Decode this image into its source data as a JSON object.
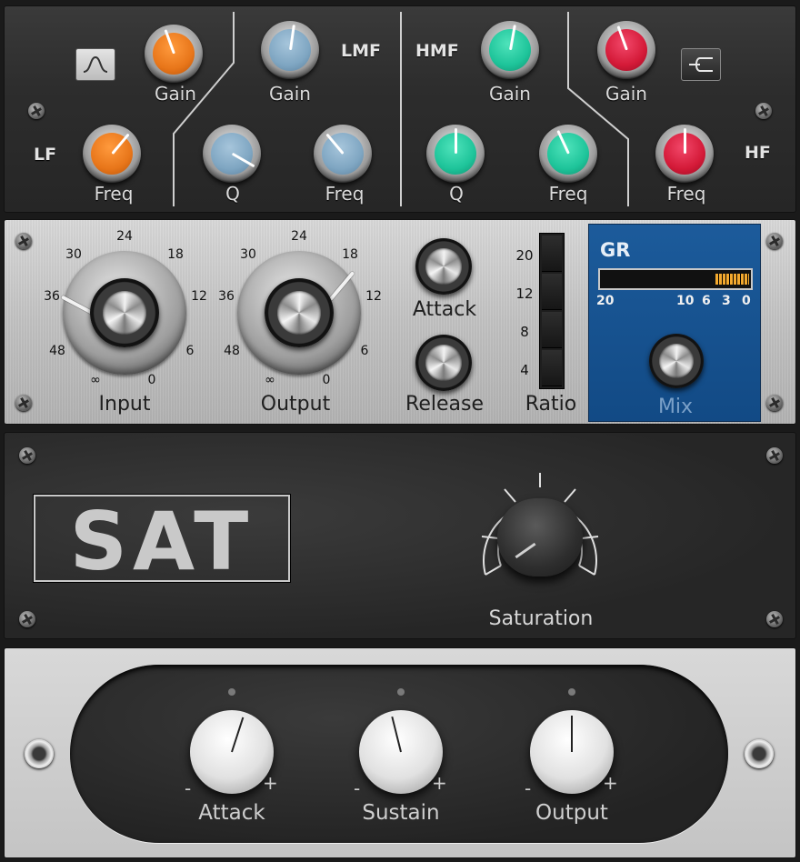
{
  "eq": {
    "lf_label": "LF",
    "lmf_label": "LMF",
    "hmf_label": "HMF",
    "hf_label": "HF",
    "lf_gain_label": "Gain",
    "lf_freq_label": "Freq",
    "lmf_gain_label": "Gain",
    "lmf_q_label": "Q",
    "lmf_freq_label": "Freq",
    "hmf_gain_label": "Gain",
    "hmf_q_label": "Q",
    "hmf_freq_label": "Freq",
    "hf_gain_label": "Gain",
    "hf_freq_label": "Freq",
    "colors": {
      "lf": "#e8761a",
      "lmf": "#7fa6c2",
      "hmf": "#1ec49a",
      "hf": "#d41a38"
    },
    "icons": {
      "lf_shape": "bell-filter-icon",
      "hf_shape": "shelf-filter-icon"
    }
  },
  "compressor": {
    "input_label": "Input",
    "output_label": "Output",
    "attack_label": "Attack",
    "release_label": "Release",
    "ratio_label": "Ratio",
    "dial_scale": [
      "24",
      "30",
      "18",
      "36",
      "12",
      "48",
      "6",
      "∞",
      "0"
    ],
    "ratio_values": [
      "20",
      "12",
      "8",
      "4"
    ],
    "gr": {
      "title": "GR",
      "scale": [
        "20",
        "10",
        "6",
        "3",
        "0"
      ],
      "mix_label": "Mix",
      "meter_level": 0.22
    },
    "colors": {
      "gr_panel": "#175495",
      "meter": "#f3a92f"
    }
  },
  "saturation": {
    "logo": "SAT",
    "knob_label": "Saturation"
  },
  "transient": {
    "attack_label": "Attack",
    "sustain_label": "Sustain",
    "output_label": "Output",
    "minus": "-",
    "plus": "+"
  }
}
